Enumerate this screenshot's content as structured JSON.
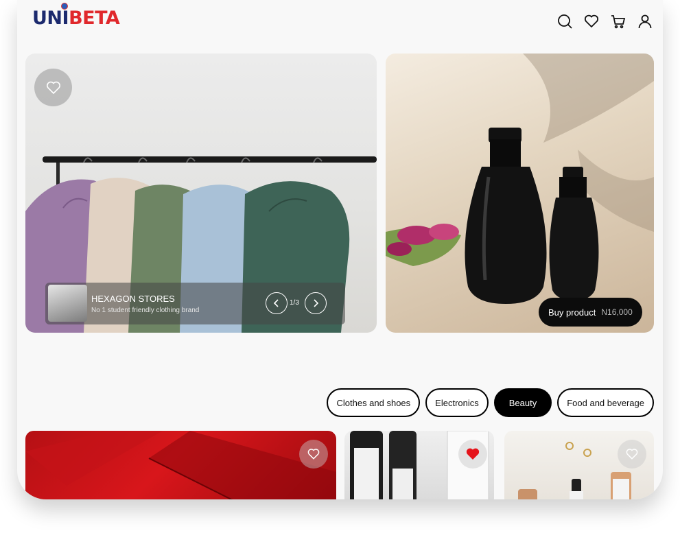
{
  "brand": {
    "logo_uni": "UNI",
    "logo_beta": "BETA"
  },
  "header": {
    "icons": [
      "search-icon",
      "heart-icon",
      "cart-icon",
      "user-icon"
    ]
  },
  "hero": {
    "store_name": "HEXAGON STORES",
    "store_description": "No 1 student friendly clothing brand",
    "slide_counter": "1/3",
    "buy_label": "Buy product",
    "buy_price": "N16,000"
  },
  "categories": [
    {
      "label": "Clothes and shoes",
      "active": false
    },
    {
      "label": "Electronics",
      "active": false
    },
    {
      "label": "Beauty",
      "active": true
    },
    {
      "label": "Food and beverage",
      "active": false
    }
  ],
  "product_cards": [
    {
      "favorited": false
    },
    {
      "favorited": true
    },
    {
      "favorited": false
    }
  ],
  "colors": {
    "brand_blue": "#1c2a6e",
    "brand_red": "#e0282c",
    "favorite_red": "#e5141b",
    "active_chip": "#000000"
  }
}
